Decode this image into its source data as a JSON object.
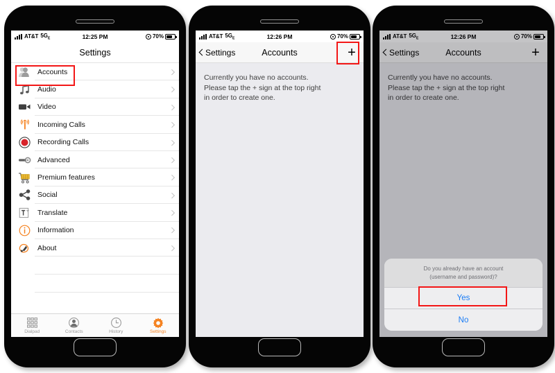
{
  "colors": {
    "accent_orange": "#f58220",
    "link_blue": "#1a7cf5",
    "highlight_red": "#f31616",
    "screen_gray": "#ebebef"
  },
  "phones": [
    {
      "name": "settings-screen",
      "status_bar": {
        "carrier": "AT&T",
        "network": "5G",
        "network_sub": "E",
        "time": "12:25 PM",
        "battery_percent": "70%"
      },
      "nav": {
        "title": "Settings"
      },
      "list": [
        {
          "label": "Accounts",
          "icon": "accounts-icon"
        },
        {
          "label": "Audio",
          "icon": "audio-note-icon"
        },
        {
          "label": "Video",
          "icon": "video-camera-icon"
        },
        {
          "label": "Incoming Calls",
          "icon": "incoming-calls-icon"
        },
        {
          "label": "Recording Calls",
          "icon": "record-dot-icon"
        },
        {
          "label": "Advanced",
          "icon": "wrench-icon"
        },
        {
          "label": "Premium features",
          "icon": "shopping-cart-icon"
        },
        {
          "label": "Social",
          "icon": "share-icon"
        },
        {
          "label": "Translate",
          "icon": "translate-icon"
        },
        {
          "label": "Information",
          "icon": "information-icon"
        },
        {
          "label": "About",
          "icon": "about-icon"
        }
      ],
      "tabs": [
        {
          "label": "Dialpad",
          "icon": "dialpad-icon",
          "active": false
        },
        {
          "label": "Contacts",
          "icon": "contacts-icon",
          "active": false
        },
        {
          "label": "History",
          "icon": "clock-icon",
          "active": false
        },
        {
          "label": "Settings",
          "icon": "gear-icon",
          "active": true
        }
      ]
    },
    {
      "name": "accounts-screen",
      "status_bar": {
        "carrier": "AT&T",
        "network": "5G",
        "network_sub": "E",
        "time": "12:26 PM",
        "battery_percent": "70%"
      },
      "nav": {
        "back_label": "Settings",
        "title": "Accounts",
        "add_label": "+"
      },
      "empty_message": "Currently you have no accounts.\nPlease tap the + sign at the top right\nin order to create one."
    },
    {
      "name": "accounts-screen-with-dialog",
      "status_bar": {
        "carrier": "AT&T",
        "network": "5G",
        "network_sub": "E",
        "time": "12:26 PM",
        "battery_percent": "70%"
      },
      "nav": {
        "back_label": "Settings",
        "title": "Accounts",
        "add_label": "+"
      },
      "empty_message": "Currently you have no accounts.\nPlease tap the + sign at the top right\nin order to create one.",
      "dialog": {
        "title": "Do you already have an account\n(username and password)?",
        "buttons": [
          {
            "label": "Yes",
            "highlighted": true
          },
          {
            "label": "No",
            "highlighted": false
          }
        ]
      }
    }
  ]
}
